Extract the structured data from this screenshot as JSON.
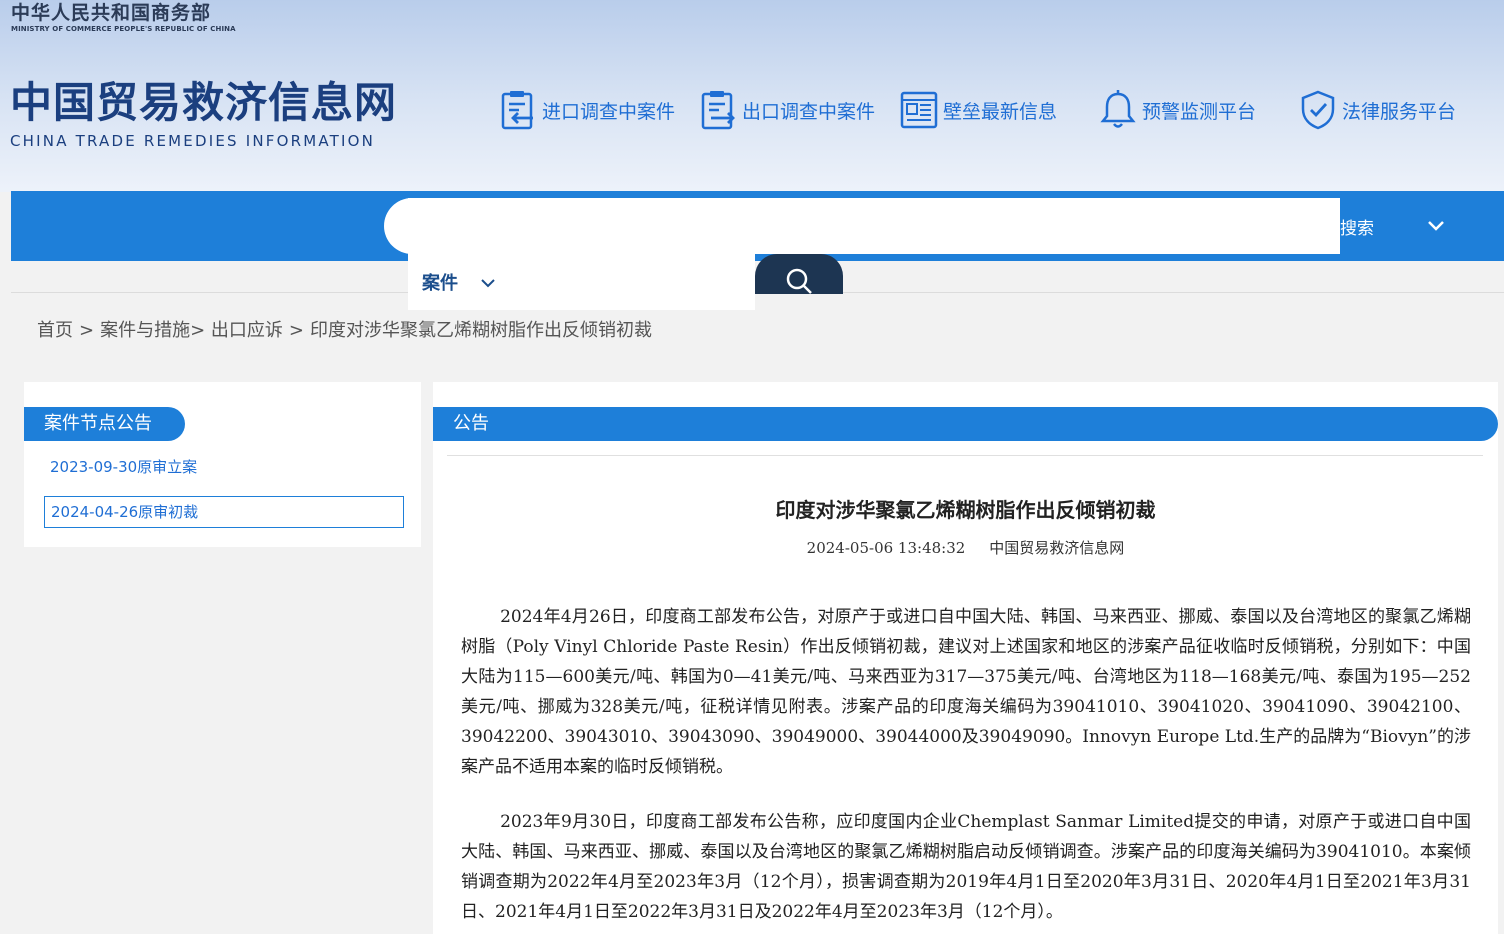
{
  "header": {
    "ministry_cn": "中华人民共和国商务部",
    "ministry_en": "MINISTRY OF COMMERCE PEOPLE'S REPUBLIC OF CHINA",
    "site_cn": "中国贸易救济信息网",
    "site_en": "CHINA TRADE REMEDIES INFORMATION"
  },
  "topnav": [
    {
      "label": "进口调查中案件",
      "icon": "import-document-icon"
    },
    {
      "label": "出口调查中案件",
      "icon": "export-document-icon"
    },
    {
      "label": "壁垒最新信息",
      "icon": "news-icon"
    },
    {
      "label": "预警监测平台",
      "icon": "bell-icon"
    },
    {
      "label": "法律服务平台",
      "icon": "shield-check-icon"
    }
  ],
  "search": {
    "type_label": "案件",
    "query": "",
    "advanced_label": "搜索"
  },
  "breadcrumb": {
    "home": "首页",
    "sep1": ">",
    "cases": "案件与措施>",
    "export": "出口应诉",
    "sep2": ">",
    "current": "印度对涉华聚氯乙烯糊树脂作出反倾销初裁"
  },
  "left": {
    "title": "案件节点公告",
    "items": [
      {
        "label": "2023-09-30原审立案"
      },
      {
        "label": "2024-04-26原审初裁"
      }
    ]
  },
  "article": {
    "tab": "公告",
    "title": "印度对涉华聚氯乙烯糊树脂作出反倾销初裁",
    "date": "2024-05-06 13:48:32",
    "source": "中国贸易救济信息网",
    "paragraphs": [
      "2024年4月26日，印度商工部发布公告，对原产于或进口自中国大陆、韩国、马来西亚、挪威、泰国以及台湾地区的聚氯乙烯糊树脂（Poly Vinyl Chloride Paste Resin）作出反倾销初裁，建议对上述国家和地区的涉案产品征收临时反倾销税，分别如下：中国大陆为115—600美元/吨、韩国为0—41美元/吨、马来西亚为317—375美元/吨、台湾地区为118—168美元/吨、泰国为195—252美元/吨、挪威为328美元/吨，征税详情见附表。涉案产品的印度海关编码为39041010、39041020、39041090、39042100、39042200、39043010、39043090、39049000、39044000及39049090。Innovyn Europe Ltd.生产的品牌为“Biovyn”的涉案产品不适用本案的临时反倾销税。",
      "2023年9月30日，印度商工部发布公告称，应印度国内企业Chemplast Sanmar Limited提交的申请，对原产于或进口自中国大陆、韩国、马来西亚、挪威、泰国以及台湾地区的聚氯乙烯糊树脂启动反倾销调查。涉案产品的印度海关编码为39041010。本案倾销调查期为2022年4月至2023年3月（12个月），损害调查期为2019年4月1日至2020年3月31日、2020年4月1日至2021年3月31日、2021年4月1日至2022年3月31日及2022年4月至2023年3月（12个月）。"
    ]
  },
  "colors": {
    "primary": "#1e7fd9",
    "link": "#1f6ed4",
    "logo": "#1b3f7f",
    "search_button": "#1d3552"
  }
}
